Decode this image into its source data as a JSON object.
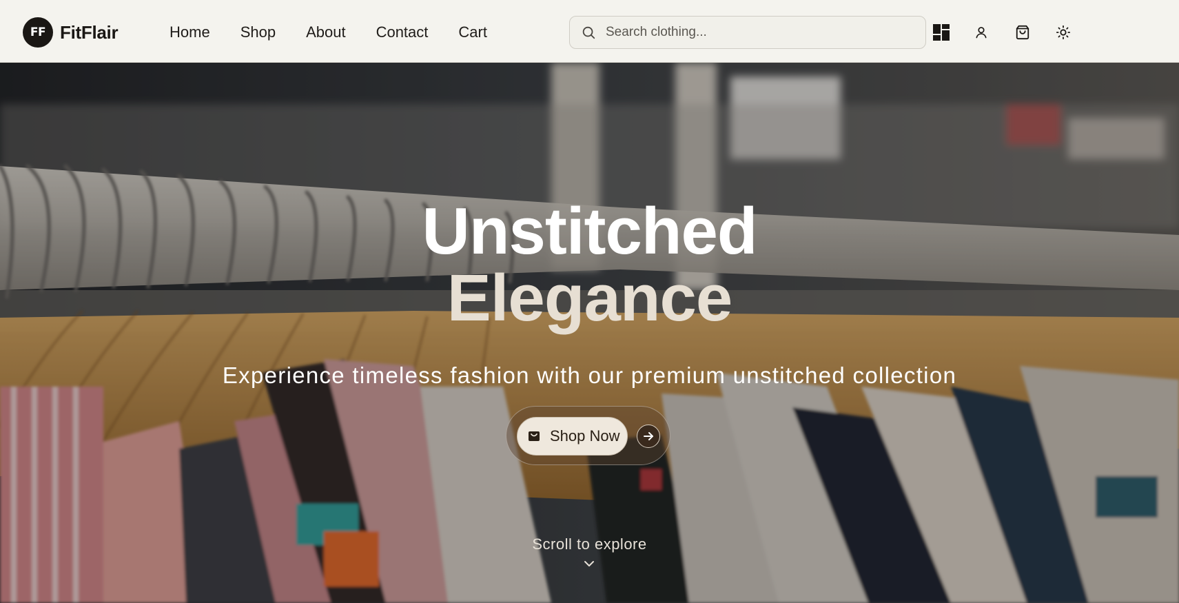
{
  "brand": {
    "mark": "FF",
    "name": "FitFlair"
  },
  "nav": {
    "items": [
      "Home",
      "Shop",
      "About",
      "Contact",
      "Cart"
    ]
  },
  "search": {
    "placeholder": "Search clothing...",
    "value": ""
  },
  "header_actions": {
    "icons": [
      "dashboard-icon",
      "user-icon",
      "shopping-bag-icon",
      "sun-icon"
    ]
  },
  "hero": {
    "title_line1": "Unstitched",
    "title_line2": "Elegance",
    "subtitle": "Experience timeless fashion with our premium unstitched collection",
    "cta_label": "Shop Now",
    "scroll_hint": "Scroll to explore"
  },
  "colors": {
    "header_bg": "#f4f3ee",
    "brand_dark": "#1a1714",
    "title_accent": "#e7dfd3",
    "cta_bg": "#efe8dd",
    "cta_arrow_bg": "#3a2a1d"
  }
}
